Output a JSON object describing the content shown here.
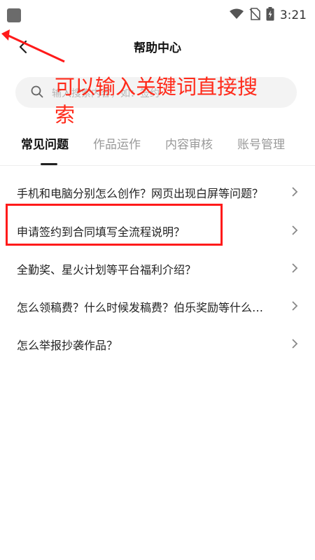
{
  "status_bar": {
    "time": "3:21"
  },
  "header": {
    "title": "帮助中心"
  },
  "search": {
    "placeholder": "输入搜索内容，如：签约"
  },
  "annotation": {
    "text": "可以输入关键词直接搜索"
  },
  "tabs": [
    {
      "label": "常见问题",
      "active": true
    },
    {
      "label": "作品运作",
      "active": false
    },
    {
      "label": "内容审核",
      "active": false
    },
    {
      "label": "账号管理",
      "active": false
    }
  ],
  "faq_items": [
    {
      "label": "手机和电脑分别怎么创作？网页出现白屏等问题？"
    },
    {
      "label": "申请签约到合同填写全流程说明？"
    },
    {
      "label": "全勤奖、星火计划等平台福利介绍？"
    },
    {
      "label": "怎么领稿费？什么时候发稿费？伯乐奖励等什么时候发？"
    },
    {
      "label": "怎么举报抄袭作品？"
    }
  ],
  "colors": {
    "annotation": "#ff2a1a",
    "highlight": "#ff1a1a",
    "search_bg": "#f3f3f3"
  }
}
